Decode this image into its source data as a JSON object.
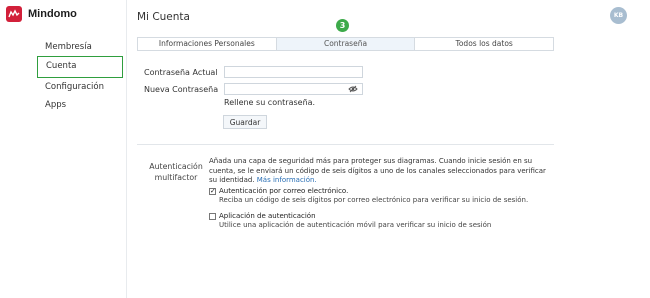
{
  "app": {
    "name": "Mindomo"
  },
  "header": {
    "title": "Mi Cuenta",
    "avatar_initials": "KB",
    "step_badge": "3"
  },
  "sidebar": {
    "items": [
      {
        "label": "Membresía"
      },
      {
        "label": "Cuenta"
      },
      {
        "label": "Configuración"
      },
      {
        "label": "Apps"
      }
    ]
  },
  "tabs": [
    {
      "label": "Informaciones Personales"
    },
    {
      "label": "Contraseña"
    },
    {
      "label": "Todos los datos"
    }
  ],
  "password": {
    "current_label": "Contraseña Actual",
    "new_label": "Nueva Contraseña",
    "hint": "Rellene su contraseña.",
    "save_label": "Guardar"
  },
  "twofa": {
    "label": "Autenticación multifactor",
    "description": "Añada una capa de seguridad más para proteger sus diagramas. Cuando inicie sesión en su cuenta, se le enviará un código de seis dígitos a uno de los canales seleccionados para verificar su identidad.",
    "more_link": "Más información.",
    "options": [
      {
        "title": "Autenticación por correo electrónico.",
        "subtitle": "Reciba un código de seis dígitos por correo electrónico para verificar su inicio de sesión.",
        "checked": true
      },
      {
        "title": "Aplicación de autenticación",
        "subtitle": "Utilice una aplicación de autenticación móvil para verificar su inicio de sesión",
        "checked": false
      }
    ]
  },
  "colors": {
    "accent_green": "#3daa4a",
    "brand_red": "#d2203a",
    "link_blue": "#2a6fb5"
  }
}
